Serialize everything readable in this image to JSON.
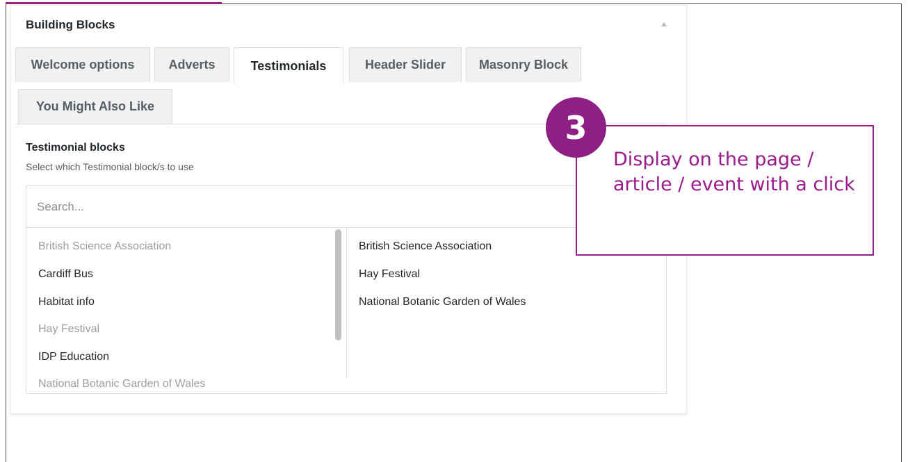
{
  "panel": {
    "title": "Building Blocks"
  },
  "tabs": [
    {
      "label": "Welcome options"
    },
    {
      "label": "Adverts"
    },
    {
      "label": "Testimonials"
    },
    {
      "label": "Header Slider"
    },
    {
      "label": "Masonry Block"
    },
    {
      "label": "You Might Also Like"
    }
  ],
  "active_tab": "Testimonials",
  "section": {
    "title": "Testimonial blocks",
    "description": "Select which Testimonial block/s to use"
  },
  "search": {
    "placeholder": "Search..."
  },
  "available_items": [
    {
      "label": "British Science Association",
      "state": "selected"
    },
    {
      "label": "Cardiff Bus",
      "state": "available"
    },
    {
      "label": "Habitat info",
      "state": "available"
    },
    {
      "label": "Hay Festival",
      "state": "selected"
    },
    {
      "label": "IDP Education",
      "state": "available"
    },
    {
      "label": "National Botanic Garden of Wales",
      "state": "selected"
    }
  ],
  "selected_items": [
    {
      "label": "British Science Association"
    },
    {
      "label": "Hay Festival"
    },
    {
      "label": "National Botanic Garden of Wales"
    }
  ],
  "callout": {
    "step": "3",
    "text": "Display on the page / article / event with a click"
  },
  "colors": {
    "accent": "#9b1b8d",
    "badge": "#8e1f85"
  }
}
